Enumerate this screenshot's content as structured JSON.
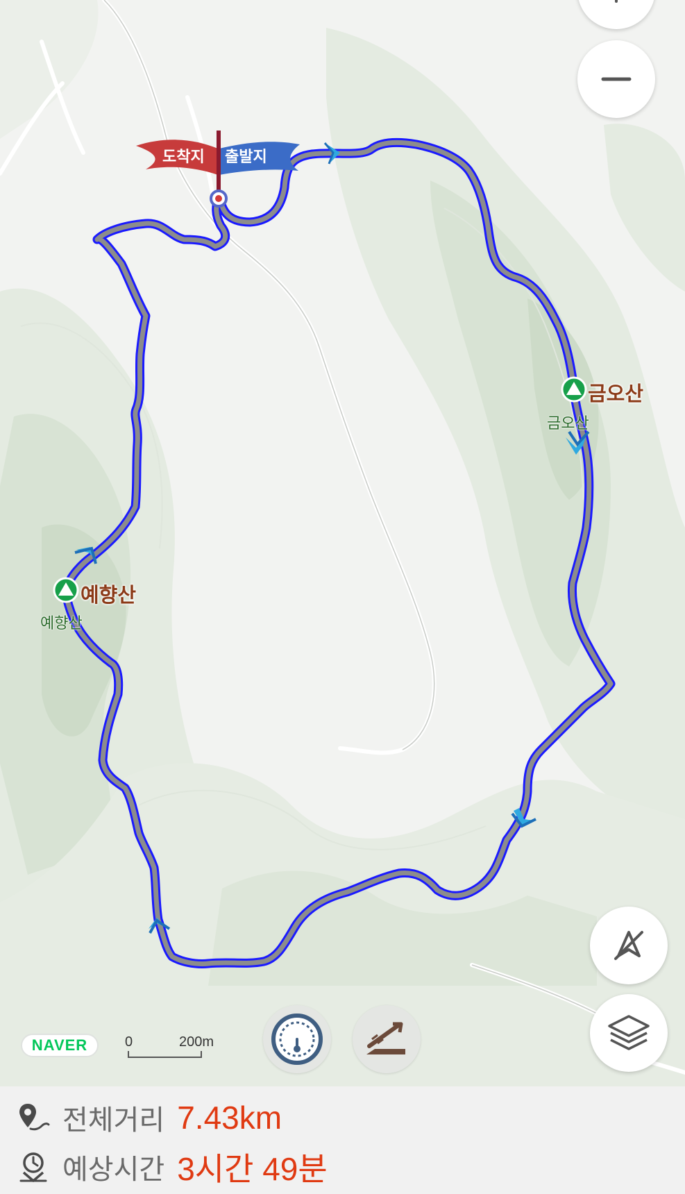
{
  "map": {
    "route": {
      "start_label": "출발지",
      "end_label": "도착지",
      "line_color": "#1a1aff",
      "inner_color": "#8c8c8c"
    },
    "peaks": [
      {
        "name": "금오산",
        "sub_label": "금오산"
      },
      {
        "name": "예향산",
        "sub_label": "예향산"
      }
    ],
    "brand_badge": "NAVER",
    "scale": {
      "zero": "0",
      "distance": "200m"
    },
    "controls": [
      {
        "name": "zoom-in",
        "icon": "plus-icon"
      },
      {
        "name": "zoom-out",
        "icon": "minus-icon"
      },
      {
        "name": "compass-off",
        "icon": "compass-disabled-icon"
      },
      {
        "name": "layers",
        "icon": "layers-icon"
      }
    ],
    "tools": [
      {
        "name": "speedometer",
        "icon": "speedometer-icon"
      },
      {
        "name": "elevation",
        "icon": "elevation-icon"
      }
    ]
  },
  "summary": {
    "distance_label": "전체거리",
    "distance_value": "7.43km",
    "time_label": "예상시간",
    "time_value": "3시간 49분",
    "accent_color": "#e03a12"
  }
}
